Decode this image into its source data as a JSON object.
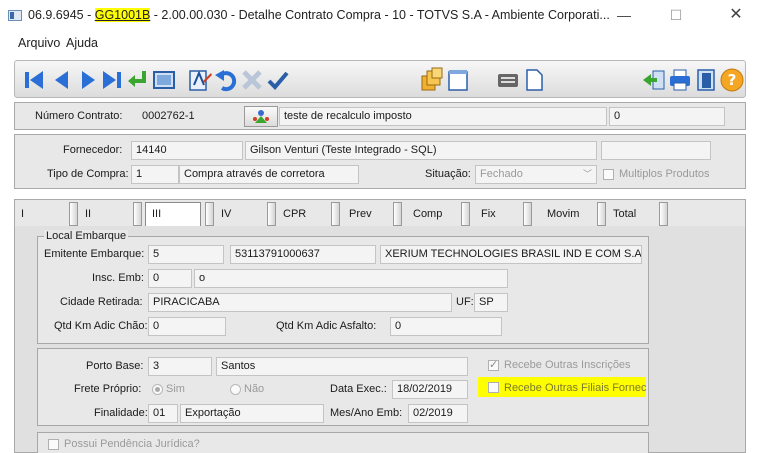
{
  "window": {
    "title_pre": "06.9.6945 - ",
    "title_code": "GG1001B",
    "title_post": " - 2.00.00.030 - Detalhe Contrato Compra - 10 - TOTVS S.A - Ambiente Corporati...",
    "min": "—",
    "max": "☐",
    "close": "✕"
  },
  "menu": {
    "arquivo": "Arquivo",
    "ajuda": "Ajuda"
  },
  "contract": {
    "numero_label": "Número Contrato:",
    "numero_value": "0002762-1",
    "descricao": "teste de recalculo imposto",
    "extra": "0"
  },
  "supplier": {
    "fornecedor_label": "Fornecedor:",
    "fornecedor_code": "14140",
    "fornecedor_name": "Gilson Venturi (Teste Integrado - SQL)",
    "tipo_label": "Tipo de Compra:",
    "tipo_code": "1",
    "tipo_desc": "Compra através de corretora",
    "situacao_label": "Situação:",
    "situacao_value": "Fechado",
    "multiplos_label": "Multiplos Produtos"
  },
  "tabs": [
    "I",
    "II",
    "III",
    "IV",
    "CPR",
    "Prev",
    "Comp",
    "Fix",
    "Movim",
    "Total"
  ],
  "embarque": {
    "group_title": "Local Embarque",
    "emitente_label": "Emitente Embarque:",
    "emitente_code": "5",
    "emitente_cnpj": "53113791000637",
    "emitente_name": "XERIUM TECHNOLOGIES BRASIL IND E COM S.A",
    "insc_label": "Insc. Emb:",
    "insc_code": "0",
    "insc_desc": "o",
    "cidade_label": "Cidade Retirada:",
    "cidade_value": "PIRACICABA",
    "uf_label": "UF:",
    "uf_value": "SP",
    "km_chao_label": "Qtd Km Adic Chão:",
    "km_chao_value": "0",
    "km_asfalto_label": "Qtd Km Adic Asfalto:",
    "km_asfalto_value": "0"
  },
  "porto": {
    "porto_label": "Porto Base:",
    "porto_code": "3",
    "porto_name": "Santos",
    "recebe_inscr_label": "Recebe Outras Inscrições",
    "frete_label": "Frete Próprio:",
    "sim_label": "Sim",
    "nao_label": "Não",
    "data_label": "Data Exec.:",
    "data_value": "18/02/2019",
    "recebe_filiais_label": "Recebe Outras Filiais Fornec",
    "finalidade_label": "Finalidade:",
    "finalidade_code": "01",
    "finalidade_desc": "Exportação",
    "mes_label": "Mes/Ano Emb:",
    "mes_value": "02/2019"
  },
  "pendencia": {
    "label": "Possui Pendência Jurídica?"
  },
  "icons": [
    "first-record-icon",
    "prev-record-icon",
    "next-record-icon",
    "last-record-icon",
    "return-icon",
    "zoom-icon",
    "edit-icon",
    "undo-icon",
    "delete-icon",
    "check-icon",
    "copy-icon",
    "notes-icon",
    "keyboard-icon",
    "document-icon",
    "navigate-icon",
    "print-icon",
    "exit-icon",
    "help-icon"
  ]
}
